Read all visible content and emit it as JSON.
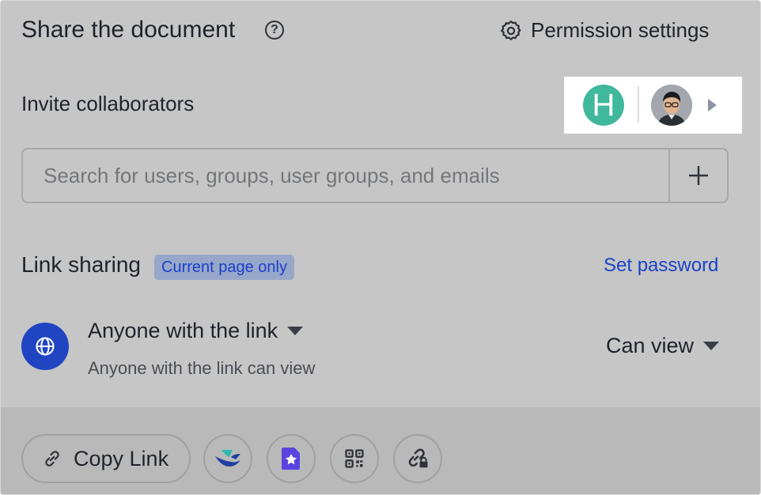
{
  "header": {
    "title": "Share the document",
    "help_glyph": "?",
    "permission_label": "Permission settings"
  },
  "invite": {
    "label": "Invite collaborators",
    "avatar_letter": "H",
    "avatar_color": "#3fb89c",
    "search_placeholder": "Search for users, groups, user groups, and emails"
  },
  "link": {
    "label": "Link sharing",
    "badge": "Current page only",
    "set_password": "Set password",
    "scope_title": "Anyone with the link",
    "scope_sub": "Anyone with the link can view",
    "permission": "Can view",
    "accent_color": "#2045c2"
  },
  "footer": {
    "copy_label": "Copy Link",
    "share_icons": [
      "lark-icon",
      "doc-star-icon",
      "qr-code-icon",
      "link-lock-icon"
    ]
  }
}
